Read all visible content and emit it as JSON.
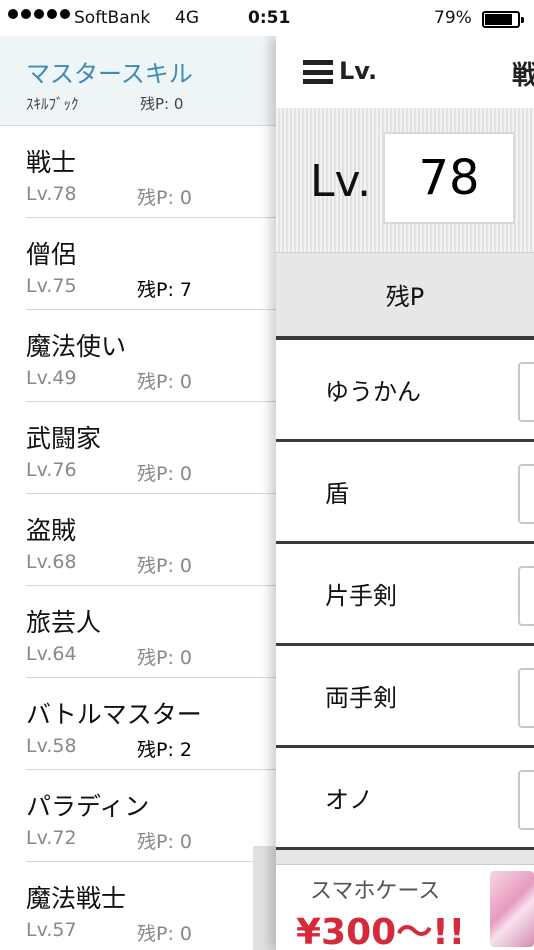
{
  "status_bar": {
    "carrier": "SoftBank",
    "network": "4G",
    "time": "0:51",
    "battery": "79%"
  },
  "menu": {
    "master": {
      "title": "マスタースキル",
      "skillbook": "ｽｷﾙﾌﾞｯｸ",
      "points": "残P: 0"
    },
    "jobs": [
      {
        "name": "戦士",
        "level": "Lv.78",
        "points": "残P: 0",
        "highlight": false
      },
      {
        "name": "僧侶",
        "level": "Lv.75",
        "points": "残P: 7",
        "highlight": true
      },
      {
        "name": "魔法使い",
        "level": "Lv.49",
        "points": "残P: 0",
        "highlight": false
      },
      {
        "name": "武闘家",
        "level": "Lv.76",
        "points": "残P: 0",
        "highlight": false
      },
      {
        "name": "盗賊",
        "level": "Lv.68",
        "points": "残P: 0",
        "highlight": false
      },
      {
        "name": "旅芸人",
        "level": "Lv.64",
        "points": "残P: 0",
        "highlight": false
      },
      {
        "name": "バトルマスター",
        "level": "Lv.58",
        "points": "残P: 2",
        "highlight": true
      },
      {
        "name": "パラディン",
        "level": "Lv.72",
        "points": "残P: 0",
        "highlight": false
      },
      {
        "name": "魔法戦士",
        "level": "Lv.57",
        "points": "残P: 0",
        "highlight": false
      }
    ]
  },
  "panel": {
    "nav_title": "Lv.",
    "nav_title_right": "戦",
    "level_label": "Lv.",
    "level_value": "78",
    "remaining_label": "残P",
    "skills": [
      "ゆうかん",
      "盾",
      "片手剣",
      "両手剣",
      "オノ"
    ]
  },
  "ad": {
    "top_text": "スマホケース",
    "price_text": "¥300〜!!"
  }
}
